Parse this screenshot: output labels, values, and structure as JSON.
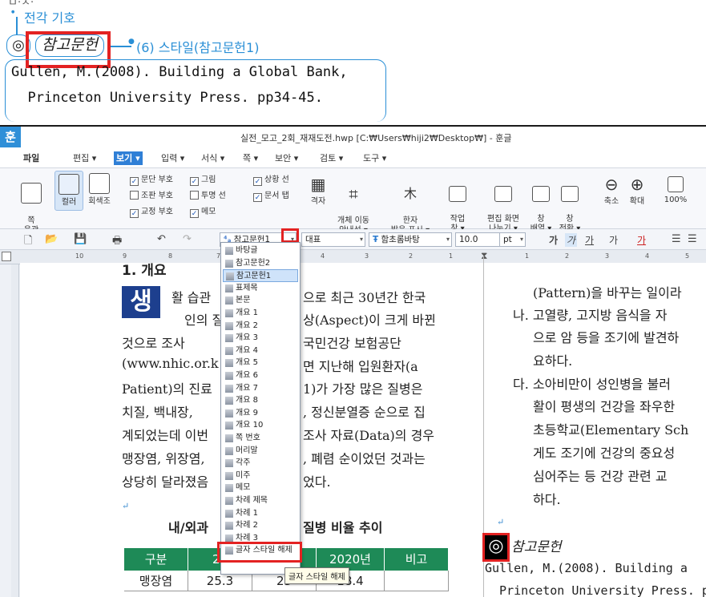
{
  "annotation": {
    "partial_top": "ㅁ·ㅈ·",
    "jeongak_label": "전각 기호",
    "symbol": "◎",
    "ref_word": "참고문헌",
    "style_note": "(6) 스타일(참고문헌1)",
    "line1": "Gullen, M.(2008). Building a Global Bank,",
    "line2": "  Princeton University Press. pp34-45."
  },
  "window": {
    "logo": "훈",
    "title": "실전_모고_2회_재재도전.hwp [C:₩Users₩hiji2₩Desktop₩] - 훈글"
  },
  "menubar": {
    "items": [
      "파일",
      "편집 ▾",
      "보기 ▾",
      "입력 ▾",
      "서식 ▾",
      "쪽 ▾",
      "보안 ▾",
      "검토 ▾",
      "도구 ▾"
    ]
  },
  "ribbon": {
    "page_layout": "쪽\n윤곽",
    "color": "컬러",
    "grayscale": "회색조",
    "checks": [
      {
        "label": "문단 부호",
        "checked": true
      },
      {
        "label": "그림",
        "checked": true
      },
      {
        "label": "상황 선",
        "checked": true
      },
      {
        "label": "조판 부호",
        "checked": false
      },
      {
        "label": "투명 선",
        "checked": false
      },
      {
        "label": "문서 탭",
        "checked": true
      },
      {
        "label": "교정 부호",
        "checked": true
      },
      {
        "label": "메모",
        "checked": true
      }
    ],
    "grid": "격자",
    "obj_move": "개체 이동\n안내선 ▾",
    "hanja": "한자\n발음 표시 ▾",
    "work_window": "작업\n창 ▾",
    "edit_split": "편집 화면\n나누기 ▾",
    "win_arrange": "창\n배열 ▾",
    "win_switch": "창\n전환 ▾",
    "zoom_out": "축소",
    "zoom_in": "확대",
    "zoom_pct": "100%"
  },
  "toolbar2": {
    "style_value": "참고문헌1",
    "lang_value": "대표",
    "font_value": "함초롬바탕",
    "size_value": "10.0",
    "size_unit": "pt"
  },
  "ruler": {
    "left_nums": [
      "10",
      "9",
      "8",
      "7"
    ],
    "right_nums": [
      "4",
      "3",
      "2",
      "1",
      "1",
      "2",
      "3",
      "4",
      "5"
    ]
  },
  "style_list": {
    "items": [
      "바탕글",
      "참고문헌2",
      "참고문헌1",
      "표제목",
      "본문",
      "개요 1",
      "개요 2",
      "개요 3",
      "개요 4",
      "개요 5",
      "개요 6",
      "개요 7",
      "개요 8",
      "개요 9",
      "개요 10",
      "쪽 번호",
      "머리말",
      "각주",
      "미주",
      "메모",
      "차례 제목",
      "차례 1",
      "차례 2",
      "차례 3",
      "글자 스타일 해제"
    ],
    "selected_index": 2
  },
  "tooltip": "글자 스타일 해제",
  "left_col": {
    "heading": "1. 개요",
    "drop_cap": "생",
    "lines": [
      "활 습관",
      "으로 최근 30년간 한국",
      "인의 질",
      "상(Aspect)이 크게 바뀐",
      "것으로   조사",
      "국민건강   보험공단",
      "(www.nhic.or.k",
      "면  지난해  입원환자(a",
      "Patient)의  진료",
      "1)가  가장  많은  질병은",
      "치질,  백내장,  ",
      ",  정신분열증  순으로  집",
      "계되었는데  이번",
      "조사  자료(Data)의  경우",
      "맹장염,  위장염,",
      ",  폐렴  순이었던  것과는",
      "상당히  달라졌음",
      "었다."
    ],
    "table_title": "내/외과",
    "table_title2": "질병  비율  추이",
    "table_headers": [
      "구분",
      "20",
      "20",
      "2020년",
      "비고"
    ],
    "table_row": [
      "맹장염",
      "25.3",
      "23",
      "18.4",
      ""
    ]
  },
  "right_col": {
    "lines": [
      "(Pattern)을 바꾸는 일이라",
      "나.  고열량,  고지방  음식을  자",
      "으로  암  등을  조기에  발견하",
      "요하다.",
      "다.  소아비만이  성인병을  불러",
      "활이  평생의  건강을  좌우한",
      "초등학교(Elementary  Sch",
      "게도  조기에  건강의  중요성",
      "심어주는  등  건강  관련  교",
      "하다."
    ],
    "ref_word": "참고문헌",
    "ref_line1": "Gullen, M.(2008). Building a",
    "ref_line2": "  Princeton University Press. p"
  },
  "colors": {
    "accent": "#2a8fd6",
    "highlight_red": "#e32222",
    "table_header": "#1e8a57"
  }
}
